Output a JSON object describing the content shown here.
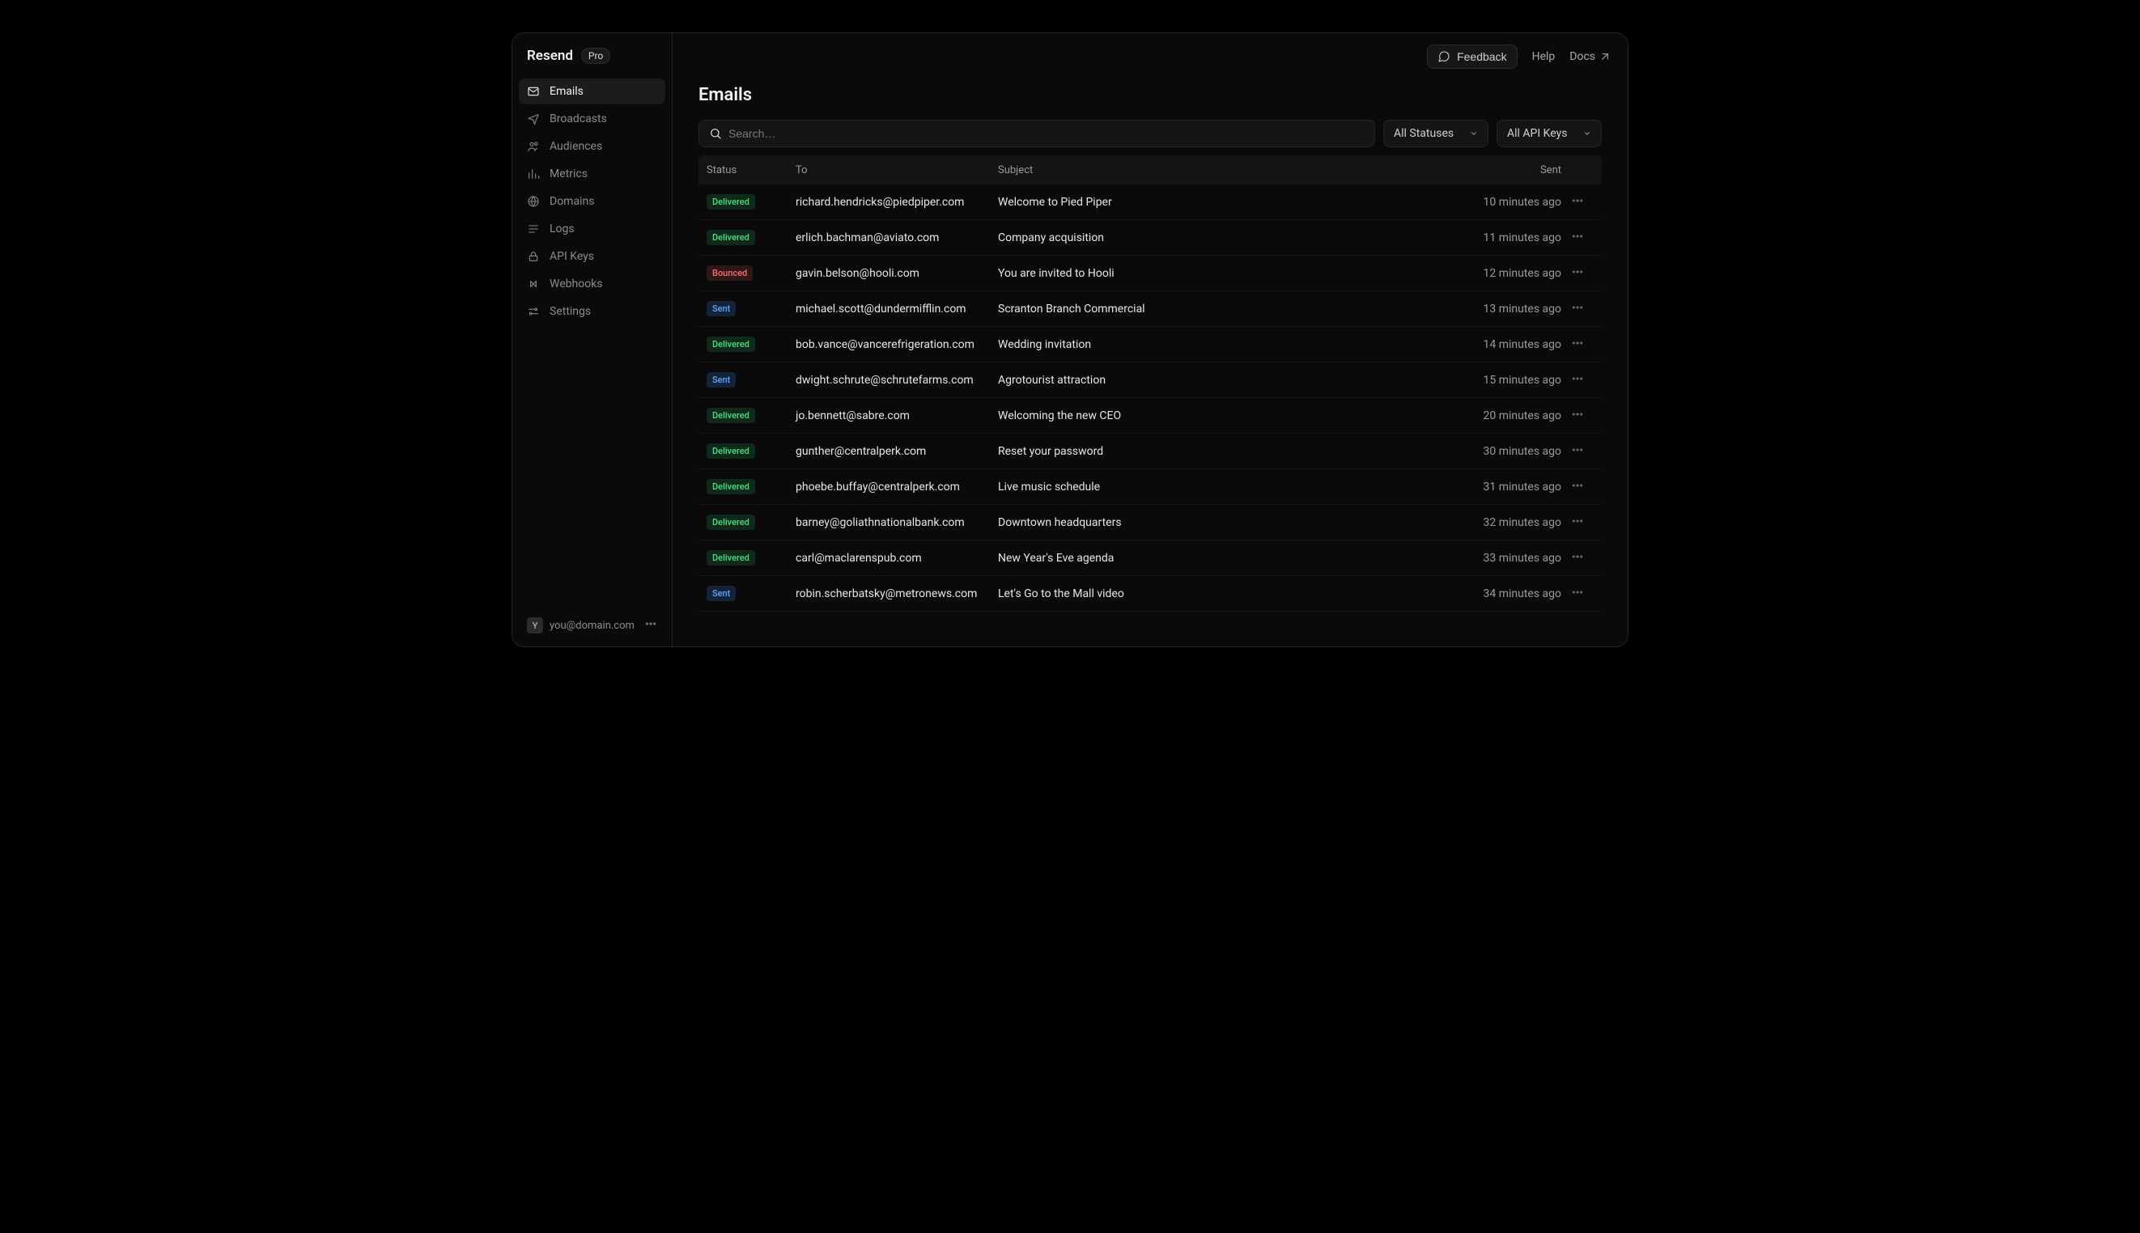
{
  "brand": {
    "name": "Resend",
    "plan": "Pro"
  },
  "sidebar": {
    "items": [
      {
        "label": "Emails",
        "icon": "mail",
        "active": true
      },
      {
        "label": "Broadcasts",
        "icon": "broadcast",
        "active": false
      },
      {
        "label": "Audiences",
        "icon": "audiences",
        "active": false
      },
      {
        "label": "Metrics",
        "icon": "metrics",
        "active": false
      },
      {
        "label": "Domains",
        "icon": "globe",
        "active": false
      },
      {
        "label": "Logs",
        "icon": "logs",
        "active": false
      },
      {
        "label": "API Keys",
        "icon": "lock",
        "active": false
      },
      {
        "label": "Webhooks",
        "icon": "webhooks",
        "active": false
      },
      {
        "label": "Settings",
        "icon": "settings",
        "active": false
      }
    ]
  },
  "topbar": {
    "feedback": "Feedback",
    "help": "Help",
    "docs": "Docs"
  },
  "page": {
    "title": "Emails"
  },
  "search": {
    "placeholder": "Search…"
  },
  "filters": {
    "status": "All Statuses",
    "apikey": "All API Keys"
  },
  "columns": {
    "status": "Status",
    "to": "To",
    "subject": "Subject",
    "sent": "Sent"
  },
  "emails": [
    {
      "status": "Delivered",
      "statusClass": "delivered",
      "to": "richard.hendricks@piedpiper.com",
      "subject": "Welcome to Pied Piper",
      "sent": "10 minutes ago"
    },
    {
      "status": "Delivered",
      "statusClass": "delivered",
      "to": "erlich.bachman@aviato.com",
      "subject": "Company acquisition",
      "sent": "11 minutes ago"
    },
    {
      "status": "Bounced",
      "statusClass": "bounced",
      "to": "gavin.belson@hooli.com",
      "subject": "You are invited to Hooli",
      "sent": "12 minutes ago"
    },
    {
      "status": "Sent",
      "statusClass": "sent",
      "to": "michael.scott@dundermifflin.com",
      "subject": "Scranton Branch Commercial",
      "sent": "13 minutes ago"
    },
    {
      "status": "Delivered",
      "statusClass": "delivered",
      "to": "bob.vance@vancerefrigeration.com",
      "subject": "Wedding invitation",
      "sent": "14 minutes ago"
    },
    {
      "status": "Sent",
      "statusClass": "sent",
      "to": "dwight.schrute@schrutefarms.com",
      "subject": "Agrotourist attraction",
      "sent": "15 minutes ago"
    },
    {
      "status": "Delivered",
      "statusClass": "delivered",
      "to": "jo.bennett@sabre.com",
      "subject": "Welcoming the new CEO",
      "sent": "20 minutes ago"
    },
    {
      "status": "Delivered",
      "statusClass": "delivered",
      "to": "gunther@centralperk.com",
      "subject": "Reset your password",
      "sent": "30 minutes ago"
    },
    {
      "status": "Delivered",
      "statusClass": "delivered",
      "to": "phoebe.buffay@centralperk.com",
      "subject": "Live music schedule",
      "sent": "31 minutes ago"
    },
    {
      "status": "Delivered",
      "statusClass": "delivered",
      "to": "barney@goliathnationalbank.com",
      "subject": "Downtown headquarters",
      "sent": "32 minutes ago"
    },
    {
      "status": "Delivered",
      "statusClass": "delivered",
      "to": "carl@maclarenspub.com",
      "subject": "New Year's Eve agenda",
      "sent": "33 minutes ago"
    },
    {
      "status": "Sent",
      "statusClass": "sent",
      "to": "robin.scherbatsky@metronews.com",
      "subject": "Let's Go to the Mall video",
      "sent": "34 minutes ago"
    }
  ],
  "user": {
    "initial": "Y",
    "email": "you@domain.com"
  }
}
